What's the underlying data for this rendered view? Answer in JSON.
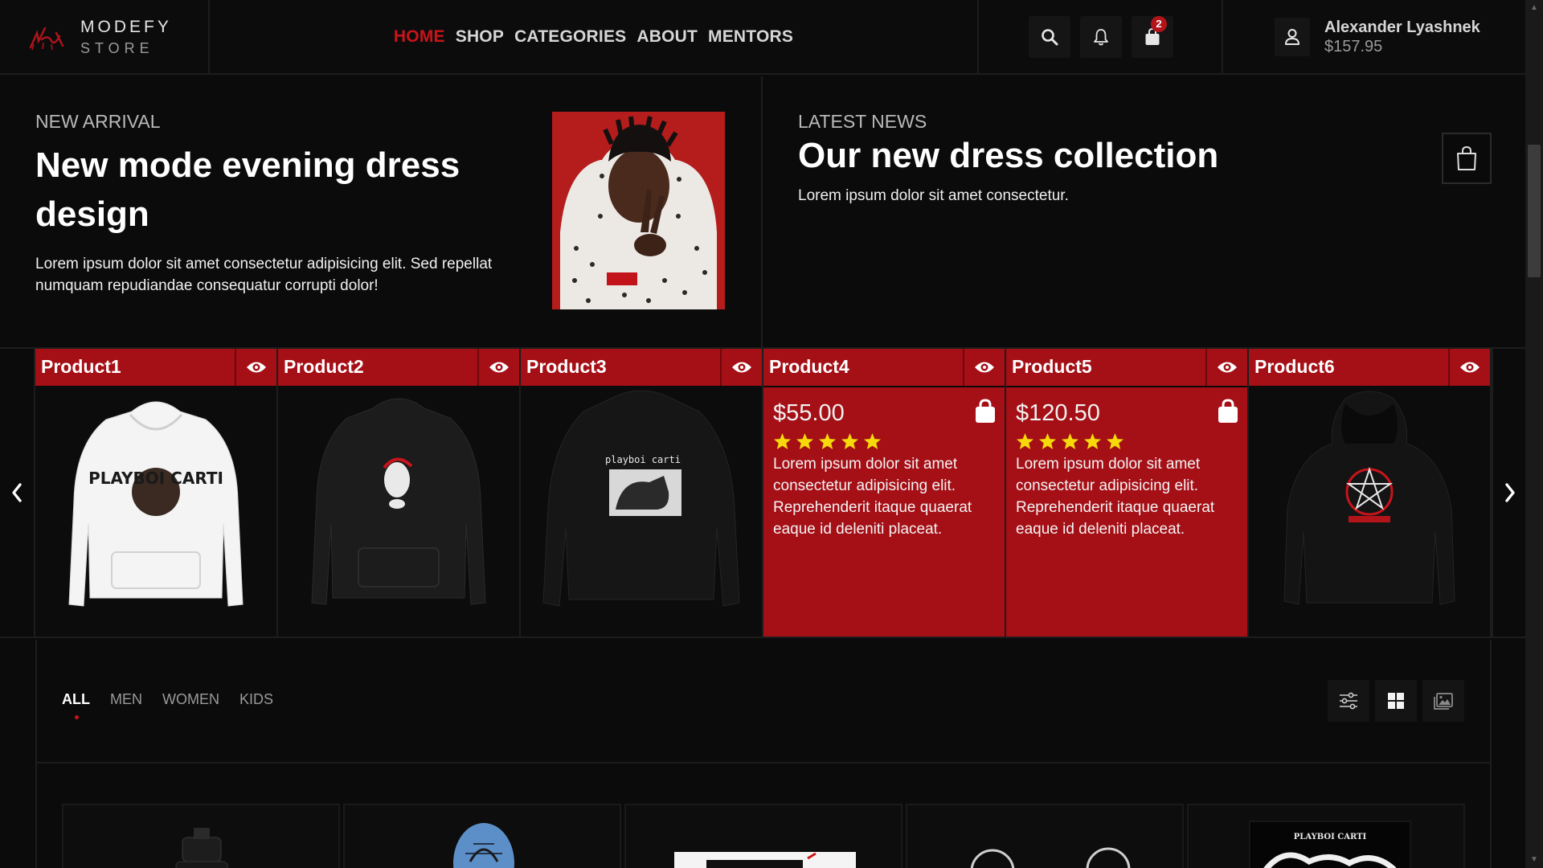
{
  "brand": {
    "title": "MODEFY",
    "subtitle": "STORE"
  },
  "nav": [
    {
      "label": "HOME",
      "active": true
    },
    {
      "label": "SHOP"
    },
    {
      "label": "CATEGORIES"
    },
    {
      "label": "ABOUT"
    },
    {
      "label": "MENTORS"
    }
  ],
  "header_icons": {
    "search": "search-icon",
    "notifications": "bell-icon",
    "cart": "shopping-bag-icon",
    "cart_count": "2"
  },
  "user": {
    "name": "Alexander Lyashnek",
    "balance": "$157.95"
  },
  "hero": {
    "eyebrow": "NEW ARRIVAL",
    "title_line1": "New mode evening dress",
    "title_line2": "design",
    "desc_line1": "Lorem ipsum dolor sit amet consectetur adipisicing elit. Sed repellat",
    "desc_line2": "numquam repudiandae consequatur corrupti dolor!"
  },
  "news": {
    "eyebrow": "LATEST NEWS",
    "title": "Our new dress collection",
    "desc": "Lorem ipsum dolor sit amet consectetur."
  },
  "products": [
    {
      "name": "Product1"
    },
    {
      "name": "Product2"
    },
    {
      "name": "Product3"
    },
    {
      "name": "Product4",
      "price": "$55.00",
      "rating": 5,
      "desc_lines": [
        "Lorem ipsum dolor sit amet",
        "consectetur adipisicing elit.",
        "Reprehenderit itaque quaerat",
        "eaque id deleniti placeat."
      ]
    },
    {
      "name": "Product5",
      "price": "$120.50",
      "rating": 5,
      "desc_lines": [
        "Lorem ipsum dolor sit amet",
        "consectetur adipisicing elit.",
        "Reprehenderit itaque quaerat",
        "eaque id deleniti placeat."
      ]
    },
    {
      "name": "Product6"
    }
  ],
  "product_artwork_text": {
    "p1": "PLAYBOI CARTI",
    "p3": "playboi carti"
  },
  "filters": {
    "tabs": [
      "ALL",
      "MEN",
      "WOMEN",
      "KIDS"
    ],
    "active": "ALL"
  },
  "view_icons": [
    "sliders-icon",
    "grid-icon",
    "gallery-icon"
  ],
  "grid_artwork_text": {
    "card5": "PLAYBOI CARTI"
  },
  "colors": {
    "accent": "#a50f16",
    "nav_active": "#c8141b",
    "background": "#0b0b0b",
    "star": "#f5d90a"
  }
}
